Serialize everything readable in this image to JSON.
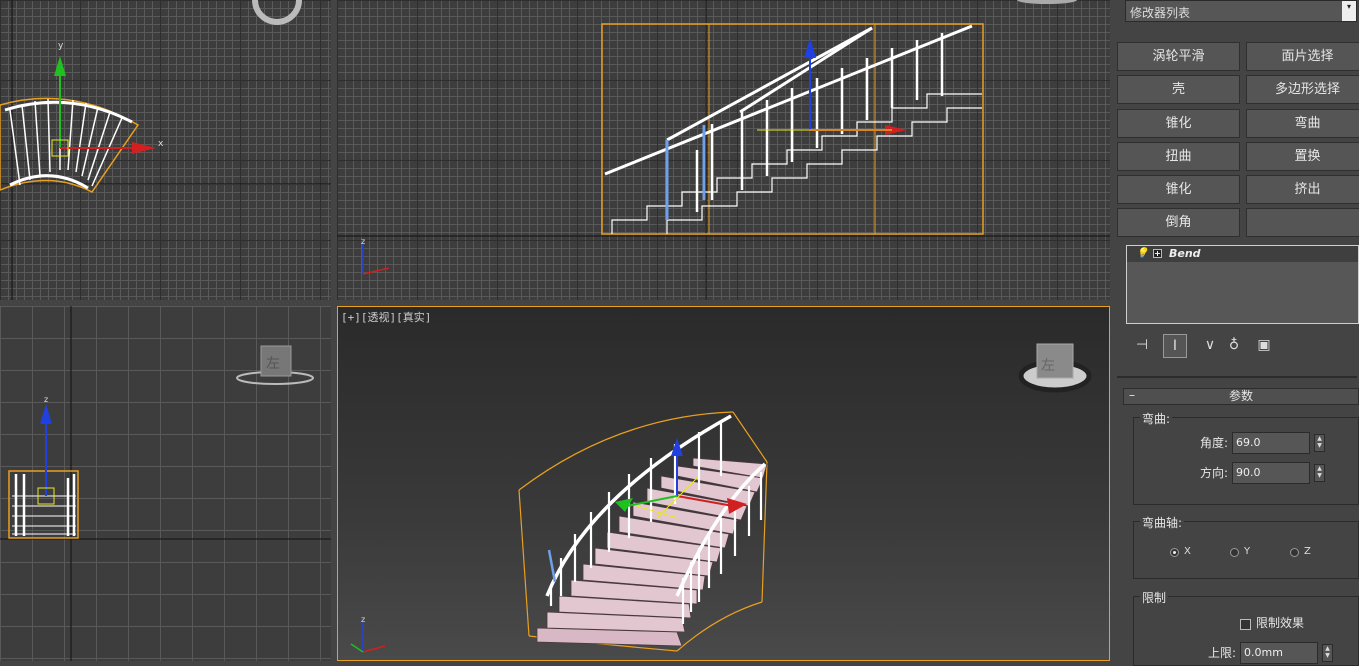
{
  "viewports": {
    "perspective_label": {
      "plus": "[+]",
      "view": "[透视]",
      "shading": "[真实]"
    },
    "left_viewcube_face": "左",
    "persp_viewcube_face": "左",
    "axis_labels": {
      "x": "x",
      "y": "y",
      "z": "z"
    }
  },
  "panel": {
    "modifier_list": "修改器列表",
    "buttons": [
      "涡轮平滑",
      "面片选择",
      "壳",
      "多边形选择",
      "锥化",
      "弯曲",
      "扭曲",
      "置换",
      "锥化",
      "挤出",
      "倒角",
      ""
    ],
    "stack": {
      "item": "Bend"
    },
    "params_rollout": "参数",
    "bend_group": "弯曲:",
    "angle_label": "角度:",
    "angle_value": "69.0",
    "direction_label": "方向:",
    "direction_value": "90.0",
    "axis_group": "弯曲轴:",
    "axis_options": [
      "X",
      "Y",
      "Z"
    ],
    "axis_selected": "X",
    "limit_group": "限制",
    "limit_effect_label": "限制效果",
    "limit_effect_checked": false,
    "upper_label": "上限:",
    "upper_value": "0.0mm"
  },
  "colors": {
    "selection": "#e8a020",
    "axis_x": "#d02020",
    "axis_y": "#20c020",
    "axis_z": "#2040e0"
  }
}
